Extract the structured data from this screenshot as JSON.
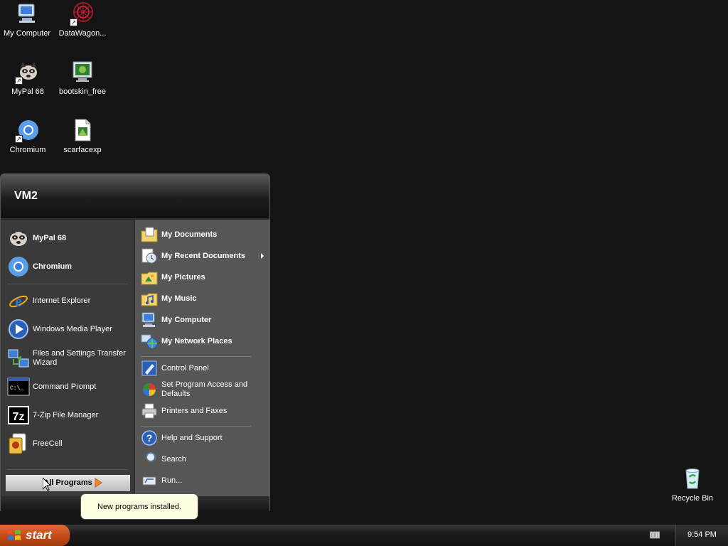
{
  "desktop": {
    "icons": [
      {
        "label": "My Computer",
        "icon": "computer-icon"
      },
      {
        "label": "DataWagon...",
        "icon": "datawagon-icon"
      },
      {
        "label": "MyPal 68",
        "icon": "raccoon-icon"
      },
      {
        "label": "bootskin_free",
        "icon": "monitor-icon"
      },
      {
        "label": "Chromium",
        "icon": "chromium-icon"
      },
      {
        "label": "scarfacexp",
        "icon": "document-icon"
      },
      {
        "label": "Recycle Bin",
        "icon": "recycle-bin-icon"
      }
    ]
  },
  "start_menu": {
    "user_name": "VM2",
    "pinned": [
      {
        "label": "MyPal 68",
        "icon": "raccoon-icon"
      },
      {
        "label": "Chromium",
        "icon": "chromium-icon"
      }
    ],
    "recent": [
      {
        "label": "Internet Explorer",
        "icon": "internet-explorer-icon"
      },
      {
        "label": "Windows Media Player",
        "icon": "media-player-icon"
      },
      {
        "label": "Files and Settings Transfer Wizard",
        "icon": "transfer-wizard-icon"
      },
      {
        "label": "Command Prompt",
        "icon": "command-prompt-icon"
      },
      {
        "label": "7-Zip File Manager",
        "icon": "7zip-icon"
      },
      {
        "label": "FreeCell",
        "icon": "freecell-icon"
      }
    ],
    "all_programs": "All Programs",
    "places": [
      {
        "label": "My Documents",
        "icon": "documents-folder-icon"
      },
      {
        "label": "My Recent Documents",
        "icon": "recent-documents-icon"
      },
      {
        "label": "My Pictures",
        "icon": "pictures-folder-icon"
      },
      {
        "label": "My Music",
        "icon": "music-folder-icon"
      },
      {
        "label": "My Computer",
        "icon": "computer-icon"
      },
      {
        "label": "My Network Places",
        "icon": "network-places-icon"
      }
    ],
    "settings": [
      {
        "label": "Control Panel",
        "icon": "control-panel-icon"
      },
      {
        "label": "Set Program Access and Defaults",
        "icon": "program-access-icon"
      },
      {
        "label": "Printers and Faxes",
        "icon": "printer-icon"
      }
    ],
    "tools": [
      {
        "label": "Help and Support",
        "icon": "help-icon"
      },
      {
        "label": "Search",
        "icon": "search-icon"
      },
      {
        "label": "Run...",
        "icon": "run-icon"
      }
    ]
  },
  "tooltip": {
    "text": "New programs installed."
  },
  "taskbar": {
    "start_label": "start",
    "clock": "9:54 PM"
  }
}
